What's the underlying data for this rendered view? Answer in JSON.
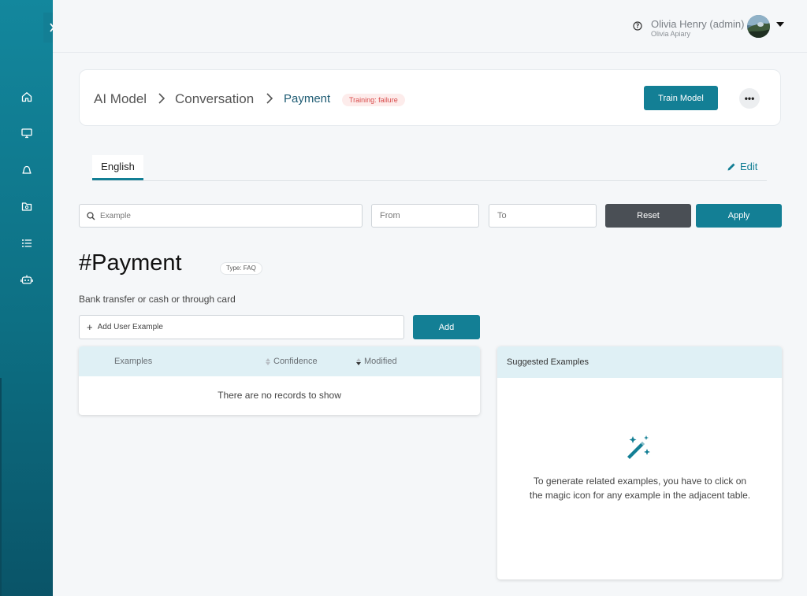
{
  "header": {
    "user_name": "Olivia Henry (admin)",
    "user_org": "Olivia Apiary"
  },
  "sidebar": {
    "items": [
      {
        "icon": "home-icon"
      },
      {
        "icon": "monitor-icon"
      },
      {
        "icon": "bell-icon"
      },
      {
        "icon": "folder-icon"
      },
      {
        "icon": "list-icon"
      },
      {
        "icon": "robot-icon"
      }
    ]
  },
  "breadcrumb": {
    "items": [
      "AI Model",
      "Conversation",
      "Payment"
    ],
    "status_badge": "Training: failure",
    "train_button": "Train Model",
    "more_button": "•••"
  },
  "tabs": {
    "items": [
      "English"
    ],
    "edit_label": "Edit"
  },
  "filters": {
    "search_placeholder": "Example",
    "from_placeholder": "From",
    "to_placeholder": "To",
    "reset_label": "Reset",
    "apply_label": "Apply"
  },
  "intent": {
    "title": "#Payment",
    "type_badge": "Type: FAQ",
    "description": "Bank transfer or cash or through card",
    "add_placeholder": "Add User Example",
    "add_button": "Add"
  },
  "examples_table": {
    "columns": [
      "Examples",
      "Confidence",
      "Modified"
    ],
    "empty_text": "There are no records to show"
  },
  "suggested": {
    "title": "Suggested Examples",
    "hint": "To generate related examples, you have to click on the magic icon for any example in the adjacent table."
  },
  "colors": {
    "accent": "#137f95",
    "sidebar": "#0d6f83",
    "failure": "#d84a4a"
  }
}
